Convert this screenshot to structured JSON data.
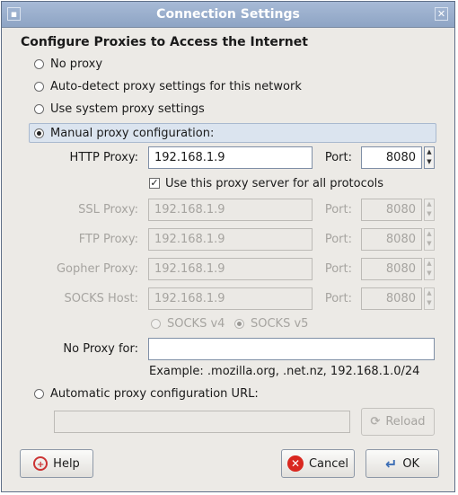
{
  "window": {
    "title": "Connection Settings",
    "close_glyph": "✕"
  },
  "heading": "Configure Proxies to Access the Internet",
  "options": {
    "no_proxy": "No proxy",
    "auto_detect": "Auto-detect proxy settings for this network",
    "system": "Use system proxy settings",
    "manual": "Manual proxy configuration:",
    "auto_url": "Automatic proxy configuration URL:"
  },
  "selected_option": "manual",
  "http": {
    "label": "HTTP Proxy:",
    "host": "192.168.1.9",
    "port_label": "Port:",
    "port": "8080"
  },
  "share": {
    "label": "Use this proxy server for all protocols",
    "checked": true
  },
  "ssl": {
    "label": "SSL Proxy:",
    "host": "192.168.1.9",
    "port_label": "Port:",
    "port": "8080"
  },
  "ftp": {
    "label": "FTP Proxy:",
    "host": "192.168.1.9",
    "port_label": "Port:",
    "port": "8080"
  },
  "gopher": {
    "label": "Gopher Proxy:",
    "host": "192.168.1.9",
    "port_label": "Port:",
    "port": "8080"
  },
  "socks": {
    "label": "SOCKS Host:",
    "host": "192.168.1.9",
    "port_label": "Port:",
    "port": "8080",
    "v4": "SOCKS v4",
    "v5": "SOCKS v5",
    "selected": "v5"
  },
  "no_proxy": {
    "label": "No Proxy for:",
    "value": "",
    "example": "Example: .mozilla.org, .net.nz, 192.168.1.0/24"
  },
  "auto_url": {
    "value": "",
    "reload": "Reload"
  },
  "buttons": {
    "help": "Help",
    "cancel": "Cancel",
    "ok": "OK"
  },
  "colors": {
    "titlebar": "#9aafcd",
    "highlight": "#dbe4ef",
    "cancel_icon": "#d9271f",
    "ok_icon": "#3b6db5"
  }
}
